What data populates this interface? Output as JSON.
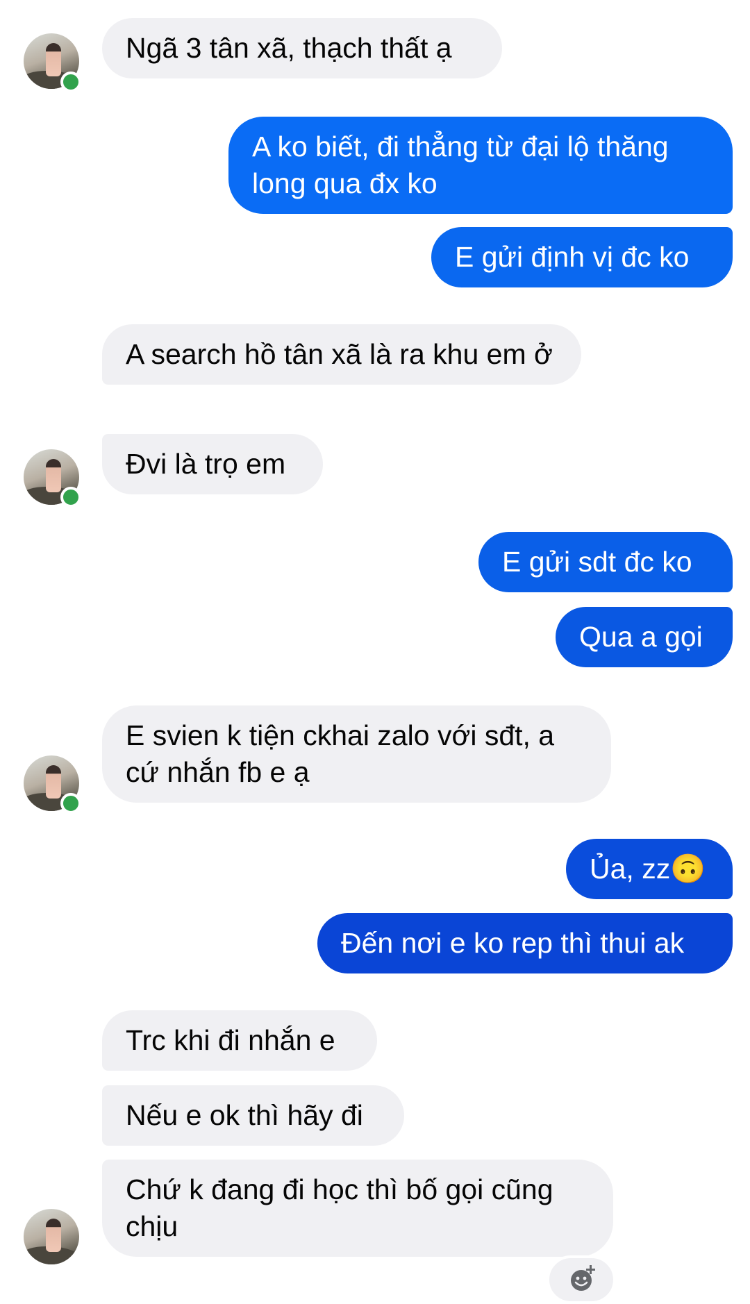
{
  "colors": {
    "incoming_bubble": "#f0f0f3",
    "outgoing_bubble_light": "#0a6cf5",
    "outgoing_bubble_dark": "#0a45d6",
    "online_indicator": "#31a24c"
  },
  "messages": [
    {
      "direction": "incoming",
      "text": "Ngã 3 tân xã, thạch thất ạ"
    },
    {
      "direction": "outgoing",
      "text": "A ko biết, đi thẳng từ đại lộ thăng long qua đx ko"
    },
    {
      "direction": "outgoing",
      "text": "E gửi định vị đc ko"
    },
    {
      "direction": "incoming",
      "text": "A search hồ tân xã là ra khu em ở"
    },
    {
      "direction": "incoming",
      "text": "Đvi là trọ em"
    },
    {
      "direction": "outgoing",
      "text": "E gửi sdt đc ko"
    },
    {
      "direction": "outgoing",
      "text": "Qua a gọi"
    },
    {
      "direction": "incoming",
      "text": "E svien k tiện ckhai zalo với sđt, a cứ nhắn fb e ạ"
    },
    {
      "direction": "outgoing",
      "text": "Ủa, zz",
      "emoji": "🙃"
    },
    {
      "direction": "outgoing",
      "text": "Đến nơi e ko rep thì thui ak"
    },
    {
      "direction": "incoming",
      "text": "Trc khi đi nhắn e"
    },
    {
      "direction": "incoming",
      "text": "Nếu e ok thì hãy đi"
    },
    {
      "direction": "incoming",
      "text": "Chứ k đang đi học thì bố gọi cũng chịu"
    }
  ],
  "reaction_button": {
    "icon": "add-reaction-icon"
  }
}
